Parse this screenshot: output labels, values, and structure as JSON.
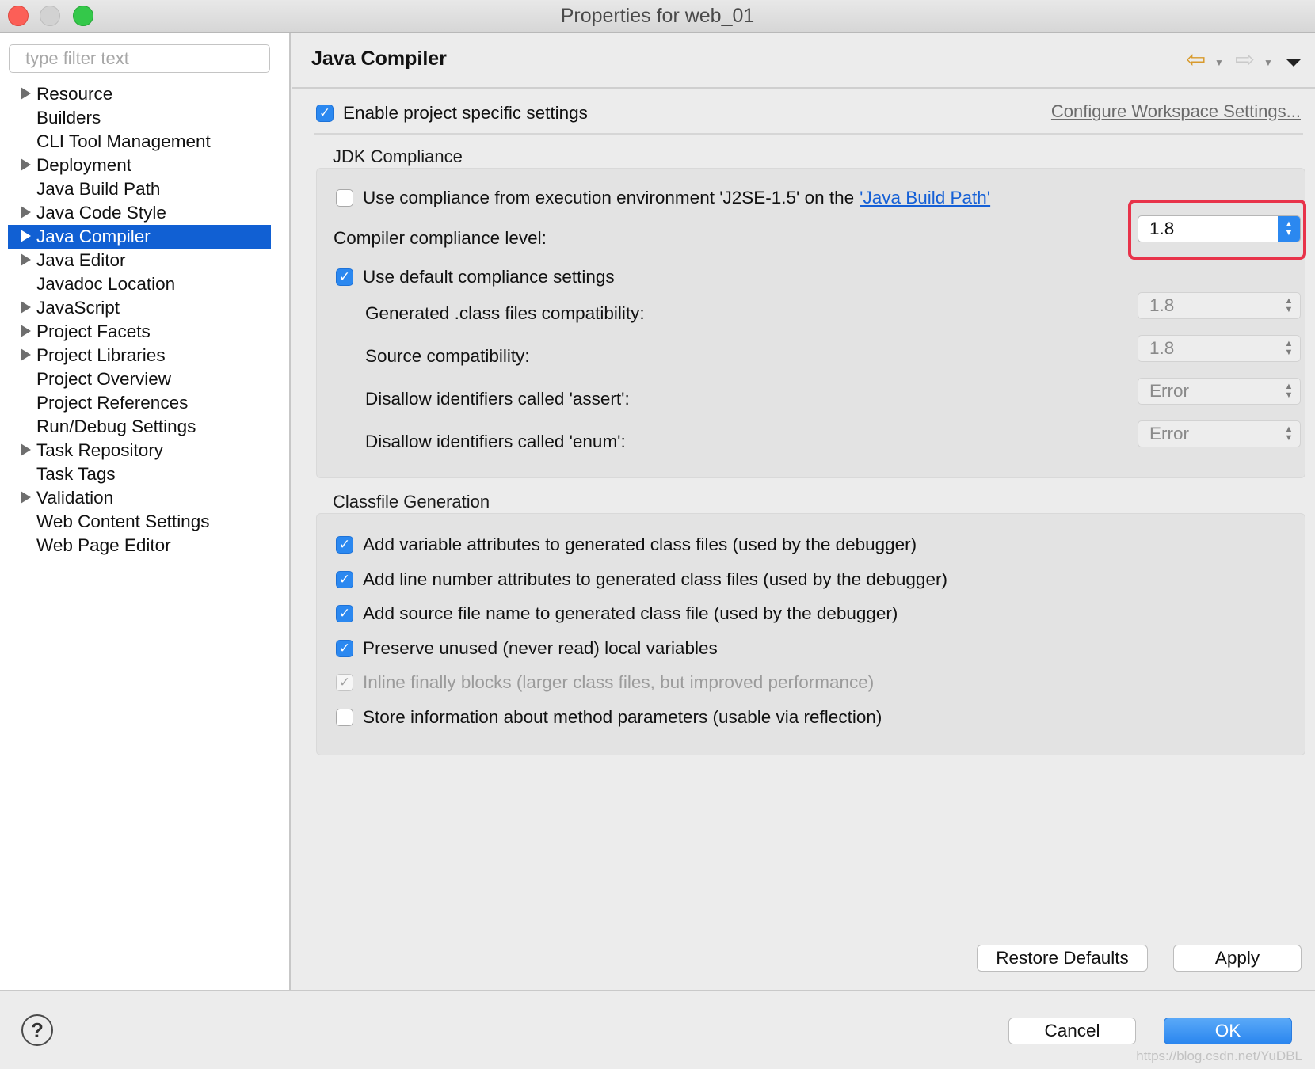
{
  "window": {
    "title": "Properties for web_01"
  },
  "sidebar": {
    "filter_placeholder": "type filter text",
    "items": [
      {
        "label": "Resource",
        "expandable": true,
        "selected": false
      },
      {
        "label": "Builders",
        "expandable": false,
        "selected": false
      },
      {
        "label": "CLI Tool Management",
        "expandable": false,
        "selected": false
      },
      {
        "label": "Deployment",
        "expandable": true,
        "selected": false
      },
      {
        "label": "Java Build Path",
        "expandable": false,
        "selected": false
      },
      {
        "label": "Java Code Style",
        "expandable": true,
        "selected": false
      },
      {
        "label": "Java Compiler",
        "expandable": true,
        "selected": true
      },
      {
        "label": "Java Editor",
        "expandable": true,
        "selected": false
      },
      {
        "label": "Javadoc Location",
        "expandable": false,
        "selected": false
      },
      {
        "label": "JavaScript",
        "expandable": true,
        "selected": false
      },
      {
        "label": "Project Facets",
        "expandable": true,
        "selected": false
      },
      {
        "label": "Project Libraries",
        "expandable": true,
        "selected": false
      },
      {
        "label": "Project Overview",
        "expandable": false,
        "selected": false
      },
      {
        "label": "Project References",
        "expandable": false,
        "selected": false
      },
      {
        "label": "Run/Debug Settings",
        "expandable": false,
        "selected": false
      },
      {
        "label": "Task Repository",
        "expandable": true,
        "selected": false
      },
      {
        "label": "Task Tags",
        "expandable": false,
        "selected": false
      },
      {
        "label": "Validation",
        "expandable": true,
        "selected": false
      },
      {
        "label": "Web Content Settings",
        "expandable": false,
        "selected": false
      },
      {
        "label": "Web Page Editor",
        "expandable": false,
        "selected": false
      }
    ]
  },
  "main": {
    "title": "Java Compiler",
    "nav": {
      "back_icon": "arrow-left-icon",
      "forward_icon": "arrow-right-icon",
      "menu_icon": "view-menu-icon"
    },
    "enable_label": "Enable project specific settings",
    "enable_checked": true,
    "configure_link": "Configure Workspace Settings...",
    "jdk": {
      "title": "JDK Compliance",
      "use_env_text": "Use compliance from execution environment 'J2SE-1.5' on the",
      "use_env_link": "'Java Build Path'",
      "use_env_checked": false,
      "compliance_label": "Compiler compliance level:",
      "compliance_value": "1.8",
      "default_label": "Use default compliance settings",
      "default_checked": true,
      "generated_label": "Generated .class files compatibility:",
      "generated_value": "1.8",
      "source_label": "Source compatibility:",
      "source_value": "1.8",
      "assert_label": "Disallow identifiers called 'assert':",
      "assert_value": "Error",
      "enum_label": "Disallow identifiers called 'enum':",
      "enum_value": "Error"
    },
    "classfile": {
      "title": "Classfile Generation",
      "options": [
        {
          "label": "Add variable attributes to generated class files (used by the debugger)",
          "checked": true,
          "disabled": false
        },
        {
          "label": "Add line number attributes to generated class files (used by the debugger)",
          "checked": true,
          "disabled": false
        },
        {
          "label": "Add source file name to generated class file (used by the debugger)",
          "checked": true,
          "disabled": false
        },
        {
          "label": "Preserve unused (never read) local variables",
          "checked": true,
          "disabled": false
        },
        {
          "label": "Inline finally blocks (larger class files, but improved performance)",
          "checked": true,
          "disabled": true
        },
        {
          "label": "Store information about method parameters (usable via reflection)",
          "checked": false,
          "disabled": false
        }
      ]
    },
    "restore_label": "Restore Defaults",
    "apply_label": "Apply"
  },
  "footer": {
    "help_icon": "help-icon",
    "help_glyph": "?",
    "cancel_label": "Cancel",
    "ok_label": "OK",
    "watermark": "https://blog.csdn.net/YuDBL"
  },
  "colors": {
    "selection": "#1160d3",
    "accent": "#2b88f0",
    "highlight": "#e8334a",
    "link": "#1560d6"
  }
}
